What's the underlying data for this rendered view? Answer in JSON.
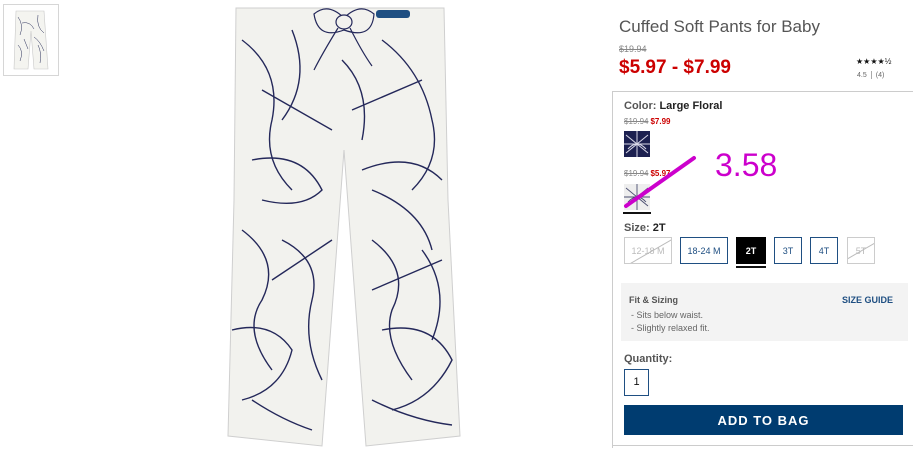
{
  "product": {
    "title": "Cuffed Soft Pants for Baby",
    "original_price": "$19.94",
    "sale_price": "$5.97 - $7.99",
    "stars": "★★★★½",
    "rating_value": "4.5",
    "review_count": "(4)"
  },
  "color": {
    "label": "Color:",
    "selected": "Large Floral",
    "swatches": [
      {
        "old_price": "$19.94",
        "new_price": "$7.99",
        "icon": "navy-floral-swatch"
      },
      {
        "old_price": "$19.94",
        "new_price": "$5.97",
        "icon": "white-floral-swatch"
      }
    ]
  },
  "annotation": {
    "text": "3.58",
    "color": "#cc00cc"
  },
  "size": {
    "label": "Size:",
    "selected": "2T",
    "options": [
      "12-18 M",
      "18-24 M",
      "2T",
      "3T",
      "4T",
      "5T"
    ]
  },
  "fit": {
    "title": "Fit & Sizing",
    "guide_label": "SIZE GUIDE",
    "items": [
      "-  Sits below waist.",
      "-  Slightly relaxed fit."
    ]
  },
  "quantity": {
    "label": "Quantity:",
    "value": "1"
  },
  "actions": {
    "add_to_bag": "ADD TO BAG"
  },
  "colors": {
    "accent": "#003c70",
    "sale": "#cc0000",
    "link": "#1f4f82"
  }
}
